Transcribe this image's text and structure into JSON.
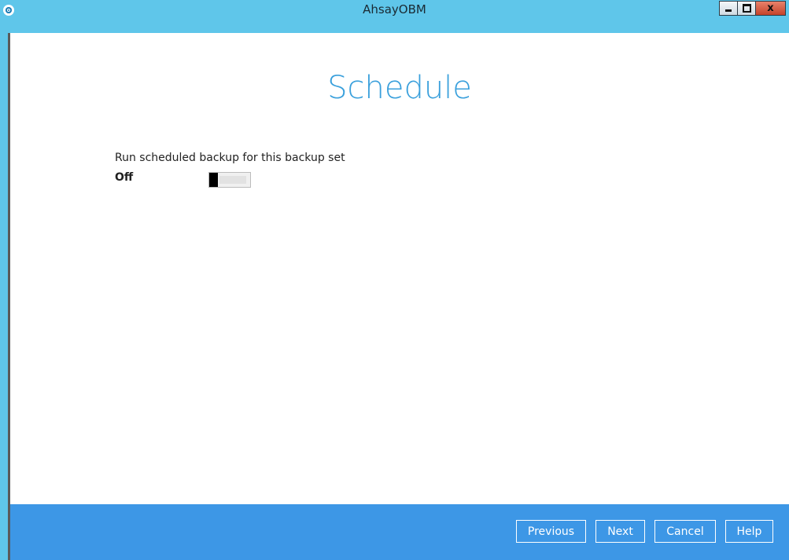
{
  "window": {
    "title": "AhsayOBM",
    "controls": {
      "minimize": "minimize",
      "maximize": "maximize",
      "close_glyph": "x"
    }
  },
  "page": {
    "title": "Schedule",
    "setting_label": "Run scheduled backup for this backup set",
    "toggle": {
      "state_label": "Off",
      "on": false
    }
  },
  "footer": {
    "buttons": {
      "previous": "Previous",
      "next": "Next",
      "cancel": "Cancel",
      "help": "Help"
    }
  },
  "colors": {
    "titlebar": "#5fc6ea",
    "page_title": "#3aa0dc",
    "footer": "#3d97e6"
  },
  "icons": {
    "app": "app-logo-icon",
    "minimize": "minimize-icon",
    "maximize": "maximize-icon",
    "close": "close-icon"
  }
}
